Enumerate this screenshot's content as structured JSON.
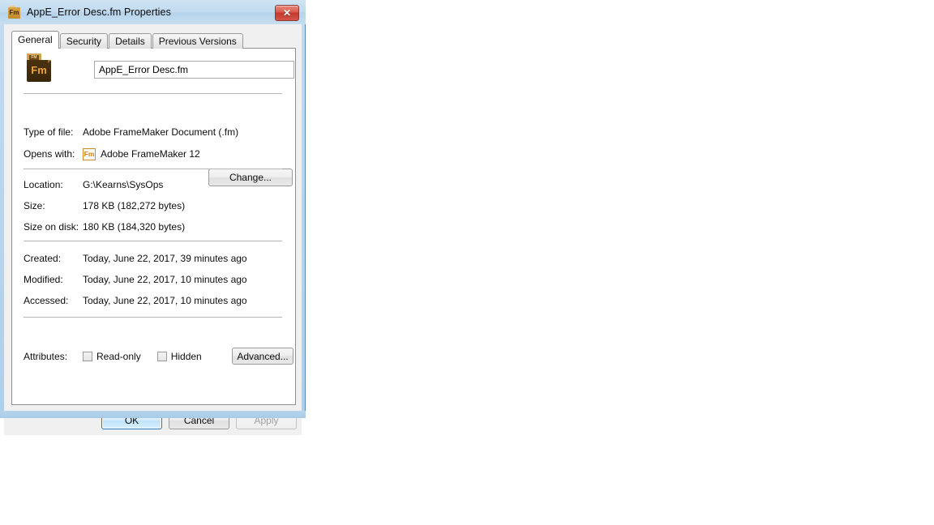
{
  "window": {
    "title": "AppE_Error Desc.fm Properties",
    "title_icon": "framemaker-document-icon",
    "close_label": "✕",
    "frame_color": "#b9d6ee"
  },
  "tabs": [
    {
      "label": "General",
      "active": true
    },
    {
      "label": "Security",
      "active": false
    },
    {
      "label": "Details",
      "active": false
    },
    {
      "label": "Previous Versions",
      "active": false
    }
  ],
  "general": {
    "icon_text": "Fm",
    "icon_tab_text": "FM",
    "filename": "AppE_Error Desc.fm",
    "rows": [
      {
        "label": "Type of file:",
        "value": "Adobe FrameMaker Document (.fm)"
      },
      {
        "label": "Opens with:",
        "value": "Adobe FrameMaker 12",
        "icon": "Fm"
      },
      {
        "label": "Location:",
        "value": "G:\\Kearns\\SysOps"
      },
      {
        "label": "Size:",
        "value": "178 KB (182,272 bytes)"
      },
      {
        "label": "Size on disk:",
        "value": "180 KB (184,320 bytes)"
      },
      {
        "label": "Created:",
        "value": "Today, June 22, 2017, 39 minutes ago"
      },
      {
        "label": "Modified:",
        "value": "Today, June 22, 2017, 10 minutes ago"
      },
      {
        "label": "Accessed:",
        "value": "Today, June 22, 2017, 10 minutes ago"
      }
    ],
    "change_button": "Change...",
    "attributes_label": "Attributes:",
    "checkboxes": [
      {
        "label": "Read-only",
        "checked": false
      },
      {
        "label": "Hidden",
        "checked": false
      }
    ],
    "advanced_button": "Advanced..."
  },
  "footer": {
    "ok": "OK",
    "cancel": "Cancel",
    "apply": "Apply",
    "apply_disabled": true
  }
}
